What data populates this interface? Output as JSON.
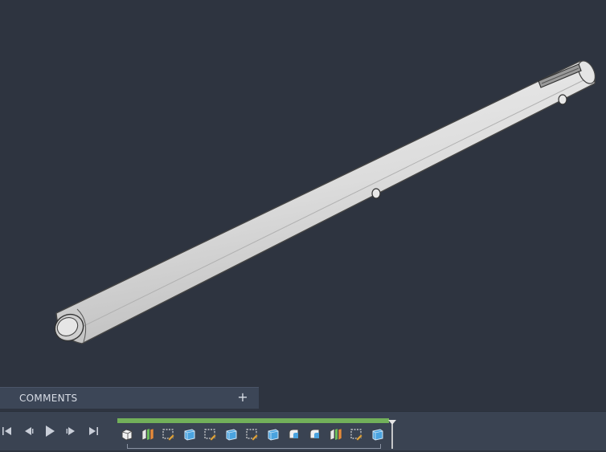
{
  "comments": {
    "label": "COMMENTS",
    "add_symbol": "+"
  },
  "playback": [
    {
      "name": "skip-to-start-icon"
    },
    {
      "name": "step-back-icon"
    },
    {
      "name": "play-icon"
    },
    {
      "name": "step-forward-icon"
    },
    {
      "name": "skip-to-end-icon"
    }
  ],
  "timeline_features": [
    "solid-body-icon",
    "split-body-icon",
    "sketch-icon",
    "extrude-icon",
    "sketch-icon",
    "extrude-icon",
    "sketch-icon",
    "extrude-icon",
    "fillet-icon",
    "fillet-icon",
    "split-body-icon",
    "sketch-icon",
    "extrude-icon"
  ],
  "colors": {
    "viewport_bg": "#2e3440",
    "model_fill": "#d9d9d9",
    "timeline_progress": "#72b05a"
  }
}
